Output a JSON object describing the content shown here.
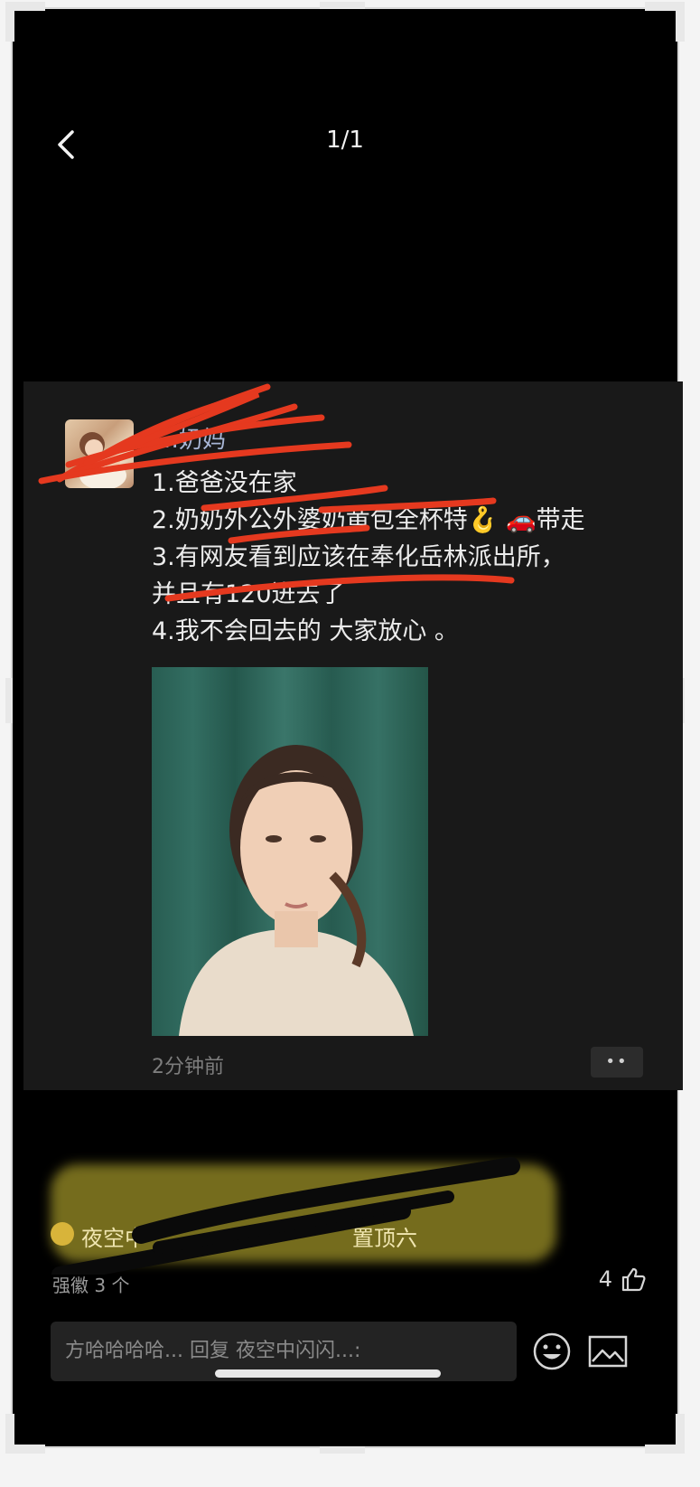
{
  "viewer": {
    "page_counter": "1/1"
  },
  "post": {
    "username": "…奶妈",
    "lines": [
      "1.爸爸没在家",
      "2.奶奶外公外婆奶黄包全杯特🪝 🚗带走",
      "3.有网友看到应该在奉化岳林派出所，",
      "并且有120进去了",
      "4.我不会回去的 大家放心 。"
    ],
    "timestamp": "2分钟前",
    "more_label": "••"
  },
  "comment": {
    "author_visible": "夜空中",
    "text_visible_tail": "置顶六",
    "sub_visible": "强徽 3 个",
    "like_count": "4"
  },
  "reply_input": {
    "placeholder": "方哈哈哈哈... 回复 夜空中闪闪...:"
  },
  "colors": {
    "background": "#000000",
    "post_background": "#191919",
    "username": "#a8b6d6",
    "scribble_red": "#e5391f",
    "highlight_yellow": "#d6c434"
  },
  "icons": {
    "back": "chevron-left-icon",
    "emoji": "smiley-icon",
    "image": "image-icon",
    "like": "thumbs-up-icon"
  }
}
